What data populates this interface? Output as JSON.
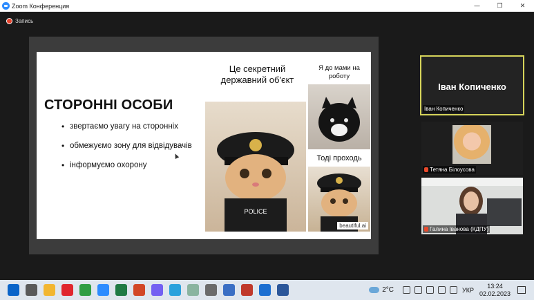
{
  "window": {
    "title": "Zoom Конференция",
    "controls": [
      "—",
      "❐",
      "✕"
    ]
  },
  "recording": {
    "label": "Запись"
  },
  "slide": {
    "title": "СТОРОННІ ОСОБИ",
    "bullets": [
      "звертаємо увагу на сторонніх",
      "обмежуємо зону для відвідувачів",
      "інформуємо охорону"
    ],
    "meme": {
      "caption_main": "Це секретний державний об'єкт",
      "caption_top_right": "Я до мами на роботу",
      "caption_bottom_right": "Тоді проходь",
      "brand": "beautiful.ai"
    }
  },
  "participants": [
    {
      "name": "Іван Копиченко",
      "display_name": "Іван Копиченко",
      "active": true
    },
    {
      "name": "Тетяна Білоусова",
      "muted": true
    },
    {
      "name": "Галина Іванова (КДПУ)",
      "muted": true
    }
  ],
  "taskbar": {
    "apps": [
      {
        "icon": "windows-start-icon",
        "color": "#0a64c8"
      },
      {
        "icon": "task-view-icon",
        "color": "#5a5a5a"
      },
      {
        "icon": "file-explorer-icon",
        "color": "#f2b631"
      },
      {
        "icon": "opera-icon",
        "color": "#e0262e"
      },
      {
        "icon": "chrome-icon",
        "color": "#2f9e44"
      },
      {
        "icon": "zoom-icon",
        "color": "#2d8cff"
      },
      {
        "icon": "excel-icon",
        "color": "#1f7a44"
      },
      {
        "icon": "powerpoint-icon",
        "color": "#d24726"
      },
      {
        "icon": "viber-icon",
        "color": "#7360f2"
      },
      {
        "icon": "telegram-icon",
        "color": "#2aa1dc"
      },
      {
        "icon": "notepad-icon",
        "color": "#8ab4a0"
      },
      {
        "icon": "calculator-icon",
        "color": "#6b6b6b"
      },
      {
        "icon": "snipping-tool-icon",
        "color": "#3a6fc4"
      },
      {
        "icon": "pdf-reader-icon",
        "color": "#c0392b"
      },
      {
        "icon": "zoom-meeting-icon",
        "color": "#1b6fd1"
      },
      {
        "icon": "word-icon",
        "color": "#2b579a"
      }
    ],
    "weather": "2°C",
    "language": "УКР",
    "time": "13:24",
    "date": "02.02.2023"
  }
}
